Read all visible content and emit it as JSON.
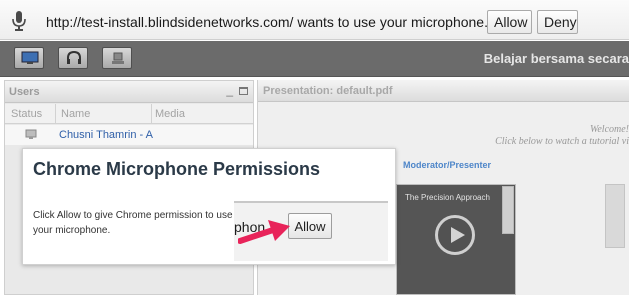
{
  "infobar": {
    "message": "http://test-install.blindsidenetworks.com/ wants to use your microphone.",
    "allow_label": "Allow",
    "deny_label": "Deny"
  },
  "app": {
    "title": "Belajar bersama secara"
  },
  "users_panel": {
    "title": "Users",
    "columns": [
      "Status",
      "Name",
      "Media"
    ],
    "rows": [
      {
        "name": "Chusni Thamrin - A"
      }
    ]
  },
  "presentation": {
    "title": "Presentation: default.pdf",
    "welcome_line1": "Welcome!",
    "welcome_line2": "Click below to watch a tutorial vi",
    "role_label": "Moderator/Presenter",
    "video_title": "The Precision Approach"
  },
  "overlay": {
    "title": "Chrome Microphone Permissions",
    "body": "Click Allow to give Chrome permission to use your microphone.",
    "inset_text": "phon",
    "inset_allow_label": "Allow"
  },
  "colors": {
    "arrow": "#e8245a",
    "toolbar": "#6b6b6b",
    "link": "#2f5fa8"
  },
  "icons": [
    "microphone-icon",
    "desktop-icon",
    "headset-icon",
    "webcam-icon",
    "user-status-icon",
    "play-icon",
    "pointer-arrow-icon"
  ]
}
